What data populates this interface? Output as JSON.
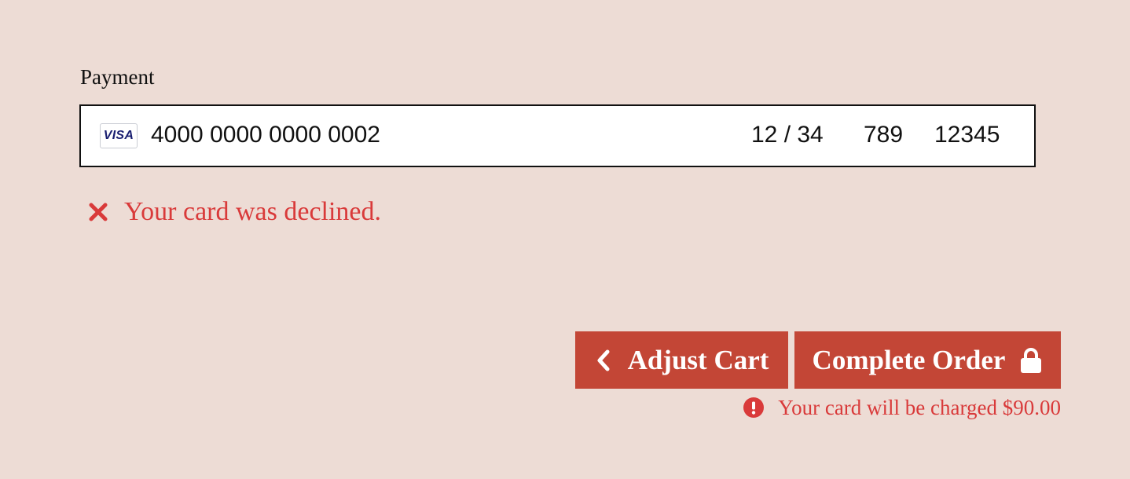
{
  "payment": {
    "label": "Payment",
    "card": {
      "brand": "VISA",
      "brand_icon": "visa-card-icon",
      "number": "4000 0000 0000 0002",
      "expiry": "12 / 34",
      "cvc": "789",
      "zip": "12345"
    },
    "error": {
      "icon": "x-mark-icon",
      "message": "Your card was declined."
    }
  },
  "actions": {
    "back": {
      "icon": "chevron-left-icon",
      "label": "Adjust Cart"
    },
    "submit": {
      "icon": "lock-icon",
      "label": "Complete Order"
    }
  },
  "notice": {
    "icon": "exclamation-circle-icon",
    "text": "Your card will be charged $90.00"
  },
  "colors": {
    "background": "#eddcd5",
    "button": "#c34636",
    "error": "#d93a3a",
    "visa_blue": "#1a1f71"
  }
}
